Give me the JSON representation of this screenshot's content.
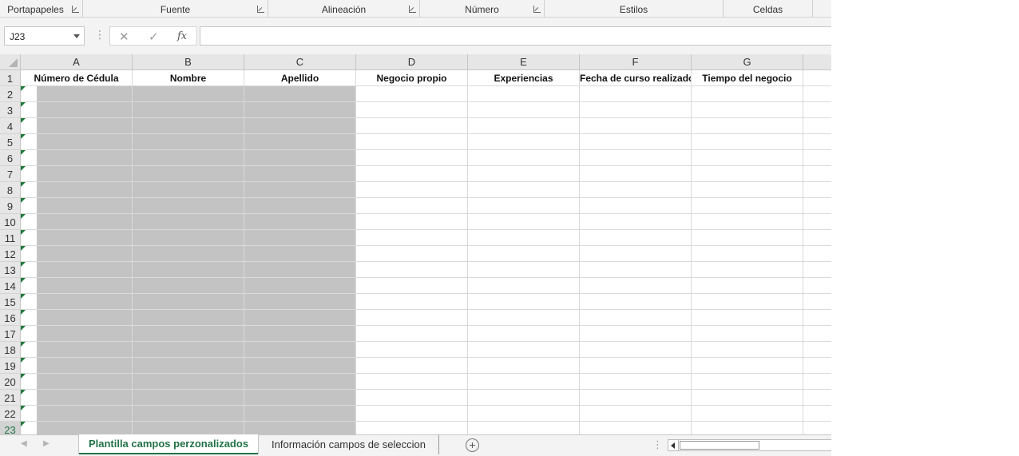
{
  "ribbon": {
    "groups": [
      {
        "label": "Portapapeles",
        "has_launcher": true
      },
      {
        "label": "Fuente",
        "has_launcher": true
      },
      {
        "label": "Alineación",
        "has_launcher": true
      },
      {
        "label": "Número",
        "has_launcher": true
      },
      {
        "label": "Estilos",
        "has_launcher": false
      },
      {
        "label": "Celdas",
        "has_launcher": false
      }
    ]
  },
  "formula_bar": {
    "name_box": "J23",
    "cancel_icon": "✕",
    "enter_icon": "✓",
    "fx_label": "fx",
    "formula_value": ""
  },
  "grid": {
    "columns": [
      "A",
      "B",
      "C",
      "D",
      "E",
      "F",
      "G"
    ],
    "rows": [
      "1",
      "2",
      "3",
      "4",
      "5",
      "6",
      "7",
      "8",
      "9",
      "10",
      "11",
      "12",
      "13",
      "14",
      "15",
      "16",
      "17",
      "18",
      "19",
      "20",
      "21",
      "22",
      "23"
    ],
    "selected_row": "23",
    "header_row": [
      "Número de Cédula",
      "Nombre",
      "Apellido",
      "Negocio propio",
      "Experiencias",
      "Fecha de curso realizado",
      "Tiempo del negocio"
    ],
    "gray_fill_color": "#c3c3c3",
    "error_indicator_color": "#1e7a36"
  },
  "sheet_tabs": {
    "active": "Plantilla campos perzonalizados",
    "others": [
      "Información campos de seleccion"
    ],
    "add_sheet_icon": "+",
    "accent_color": "#217346"
  }
}
